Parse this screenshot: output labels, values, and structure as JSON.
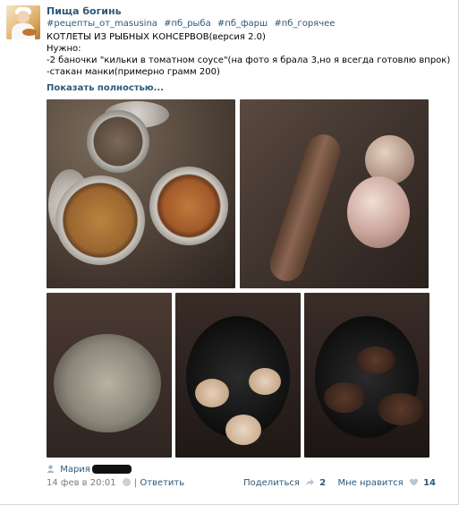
{
  "post": {
    "author": "Пища богинь",
    "tags": [
      "#рецепты_от_masusina",
      "#пб_рыба",
      "#пб_фарш",
      "#пб_горячее"
    ],
    "lines": [
      "КОТЛЕТЫ ИЗ РЫБНЫХ КОНСЕРВОВ(версия 2.0)",
      "Нужно:",
      "-2 баночки \"кильки в томатном соусе\"(на фото я брала 3,но я всегда готовлю впрок)",
      "-стакан манки(примерно грамм 200)"
    ],
    "show_more": "Показать полностью..."
  },
  "footer": {
    "user_label": "Мария",
    "date": "14 фев в 20:01",
    "reply": "Ответить",
    "share_label": "Поделиться",
    "share_count": "2",
    "like_label": "Мне нравится",
    "like_count": "14"
  },
  "icons": {
    "user": "user-icon",
    "share": "share-icon",
    "like": "heart-icon",
    "reply_hint": "info-icon"
  },
  "colors": {
    "link": "#2b587a",
    "meta": "#7a7a7a"
  }
}
